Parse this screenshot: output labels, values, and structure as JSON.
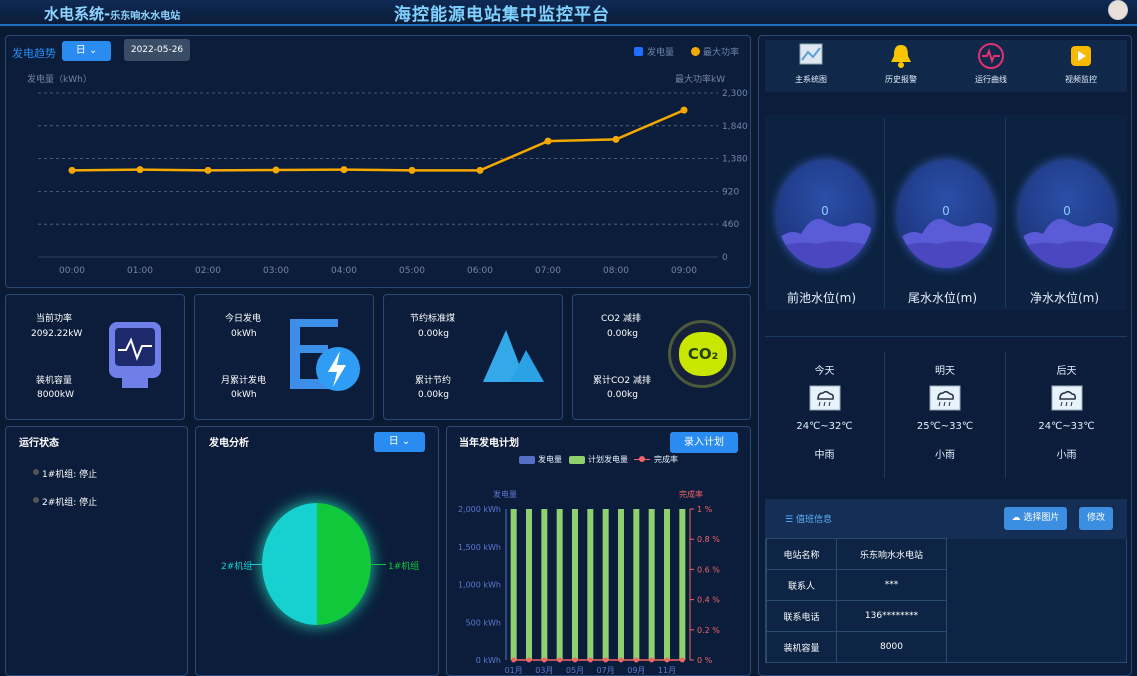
{
  "header": {
    "system_title": "水电系统-",
    "station_name": "乐东响水水电站",
    "main_title": "海控能源电站集中监控平台"
  },
  "trend": {
    "title": "发电趋势",
    "period": "日",
    "date": "2022-05-26",
    "legend_energy": "发电量",
    "legend_power": "最大功率",
    "left_unit": "发电量（kWh）",
    "right_unit": "最大功率kW",
    "chart_data": {
      "type": "line",
      "x": [
        "00:00",
        "01:00",
        "02:00",
        "03:00",
        "04:00",
        "05:00",
        "06:00",
        "07:00",
        "08:00",
        "09:00"
      ],
      "series": [
        {
          "name": "最大功率",
          "values": [
            1215,
            1225,
            1215,
            1220,
            1225,
            1215,
            1215,
            1625,
            1650,
            2060
          ]
        }
      ],
      "y_ticks": [
        "2,300",
        "1,840",
        "1,380",
        "920",
        "460",
        "0"
      ],
      "ylim": [
        0,
        2300
      ],
      "colors": {
        "power": "#f5a800",
        "energy": "#1f6fff"
      }
    }
  },
  "stats": {
    "current_power_label": "当前功率",
    "current_power": "2092.22kW",
    "capacity_label": "装机容量",
    "capacity": "8000kW",
    "today_gen_label": "今日发电",
    "today_gen": "0kWh",
    "month_gen_label": "月累计发电",
    "month_gen": "0kWh",
    "coal_label": "节约标准煤",
    "coal": "0.00kg",
    "total_saving_label": "累计节约",
    "total_saving": "0.00kg",
    "co2_label": "CO2 减排",
    "co2": "0.00kg",
    "co2_total_label": "累计CO2 减排",
    "co2_total": "0.00kg",
    "co2_icon": "CO₂"
  },
  "run_status": {
    "title": "运行状态",
    "items": [
      "1#机组: 停止",
      "2#机组: 停止"
    ]
  },
  "gen_analysis": {
    "title": "发电分析",
    "period": "日",
    "label_left": "2#机组",
    "label_right": "1#机组"
  },
  "plan": {
    "title": "当年发电计划",
    "enter_button": "录入计划",
    "legend": [
      "发电量",
      "计划发电量",
      "完成率"
    ],
    "left_axis_title": "发电量",
    "right_axis_title": "完成率",
    "left_ticks": [
      "2,000 kWh",
      "1,500 kWh",
      "1,000 kWh",
      "500 kWh",
      "0 kWh"
    ],
    "right_ticks": [
      "1 %",
      "0.8 %",
      "0.6 %",
      "0.4 %",
      "0.2 %",
      "0 %"
    ],
    "x_labels": [
      "01月",
      "03月",
      "05月",
      "07月",
      "09月",
      "11月"
    ],
    "chart_data": {
      "type": "bar",
      "categories": [
        "01月",
        "02月",
        "03月",
        "04月",
        "05月",
        "06月",
        "07月",
        "08月",
        "09月",
        "10月",
        "11月",
        "12月"
      ],
      "series": [
        {
          "name": "发电量",
          "values": [
            0,
            0,
            0,
            0,
            0,
            0,
            0,
            0,
            0,
            0,
            0,
            0
          ]
        },
        {
          "name": "计划发电量",
          "values": [
            2000,
            2000,
            2000,
            2000,
            2000,
            2000,
            2000,
            2000,
            2000,
            2000,
            2000,
            2000
          ]
        },
        {
          "name": "完成率",
          "values": [
            0,
            0,
            0,
            0,
            0,
            0,
            0,
            0,
            0,
            0,
            0,
            0
          ]
        }
      ],
      "ylim": [
        0,
        2000
      ],
      "colors": {
        "plan": "#8fd16e",
        "actual": "#5470c6",
        "rate": "#ee6666"
      }
    }
  },
  "toolbar": {
    "items": [
      "主系统图",
      "历史报警",
      "运行曲线",
      "视频监控"
    ]
  },
  "water_levels": [
    {
      "value": "0",
      "label": "前池水位(m)"
    },
    {
      "value": "0",
      "label": "尾水水位(m)"
    },
    {
      "value": "0",
      "label": "净水水位(m)"
    }
  ],
  "weather": [
    {
      "day": "今天",
      "temp": "24℃~32℃",
      "desc": "中雨"
    },
    {
      "day": "明天",
      "temp": "25℃~33℃",
      "desc": "小雨"
    },
    {
      "day": "后天",
      "temp": "24℃~33℃",
      "desc": "小雨"
    }
  ],
  "duty": {
    "title": "值班信息",
    "choose_image": "选择图片",
    "edit": "修改",
    "rows": [
      {
        "k": "电站名称",
        "v": "乐东响水水电站"
      },
      {
        "k": "联系人",
        "v": "***"
      },
      {
        "k": "联系电话",
        "v": "136********"
      },
      {
        "k": "装机容量",
        "v": "8000"
      }
    ]
  }
}
